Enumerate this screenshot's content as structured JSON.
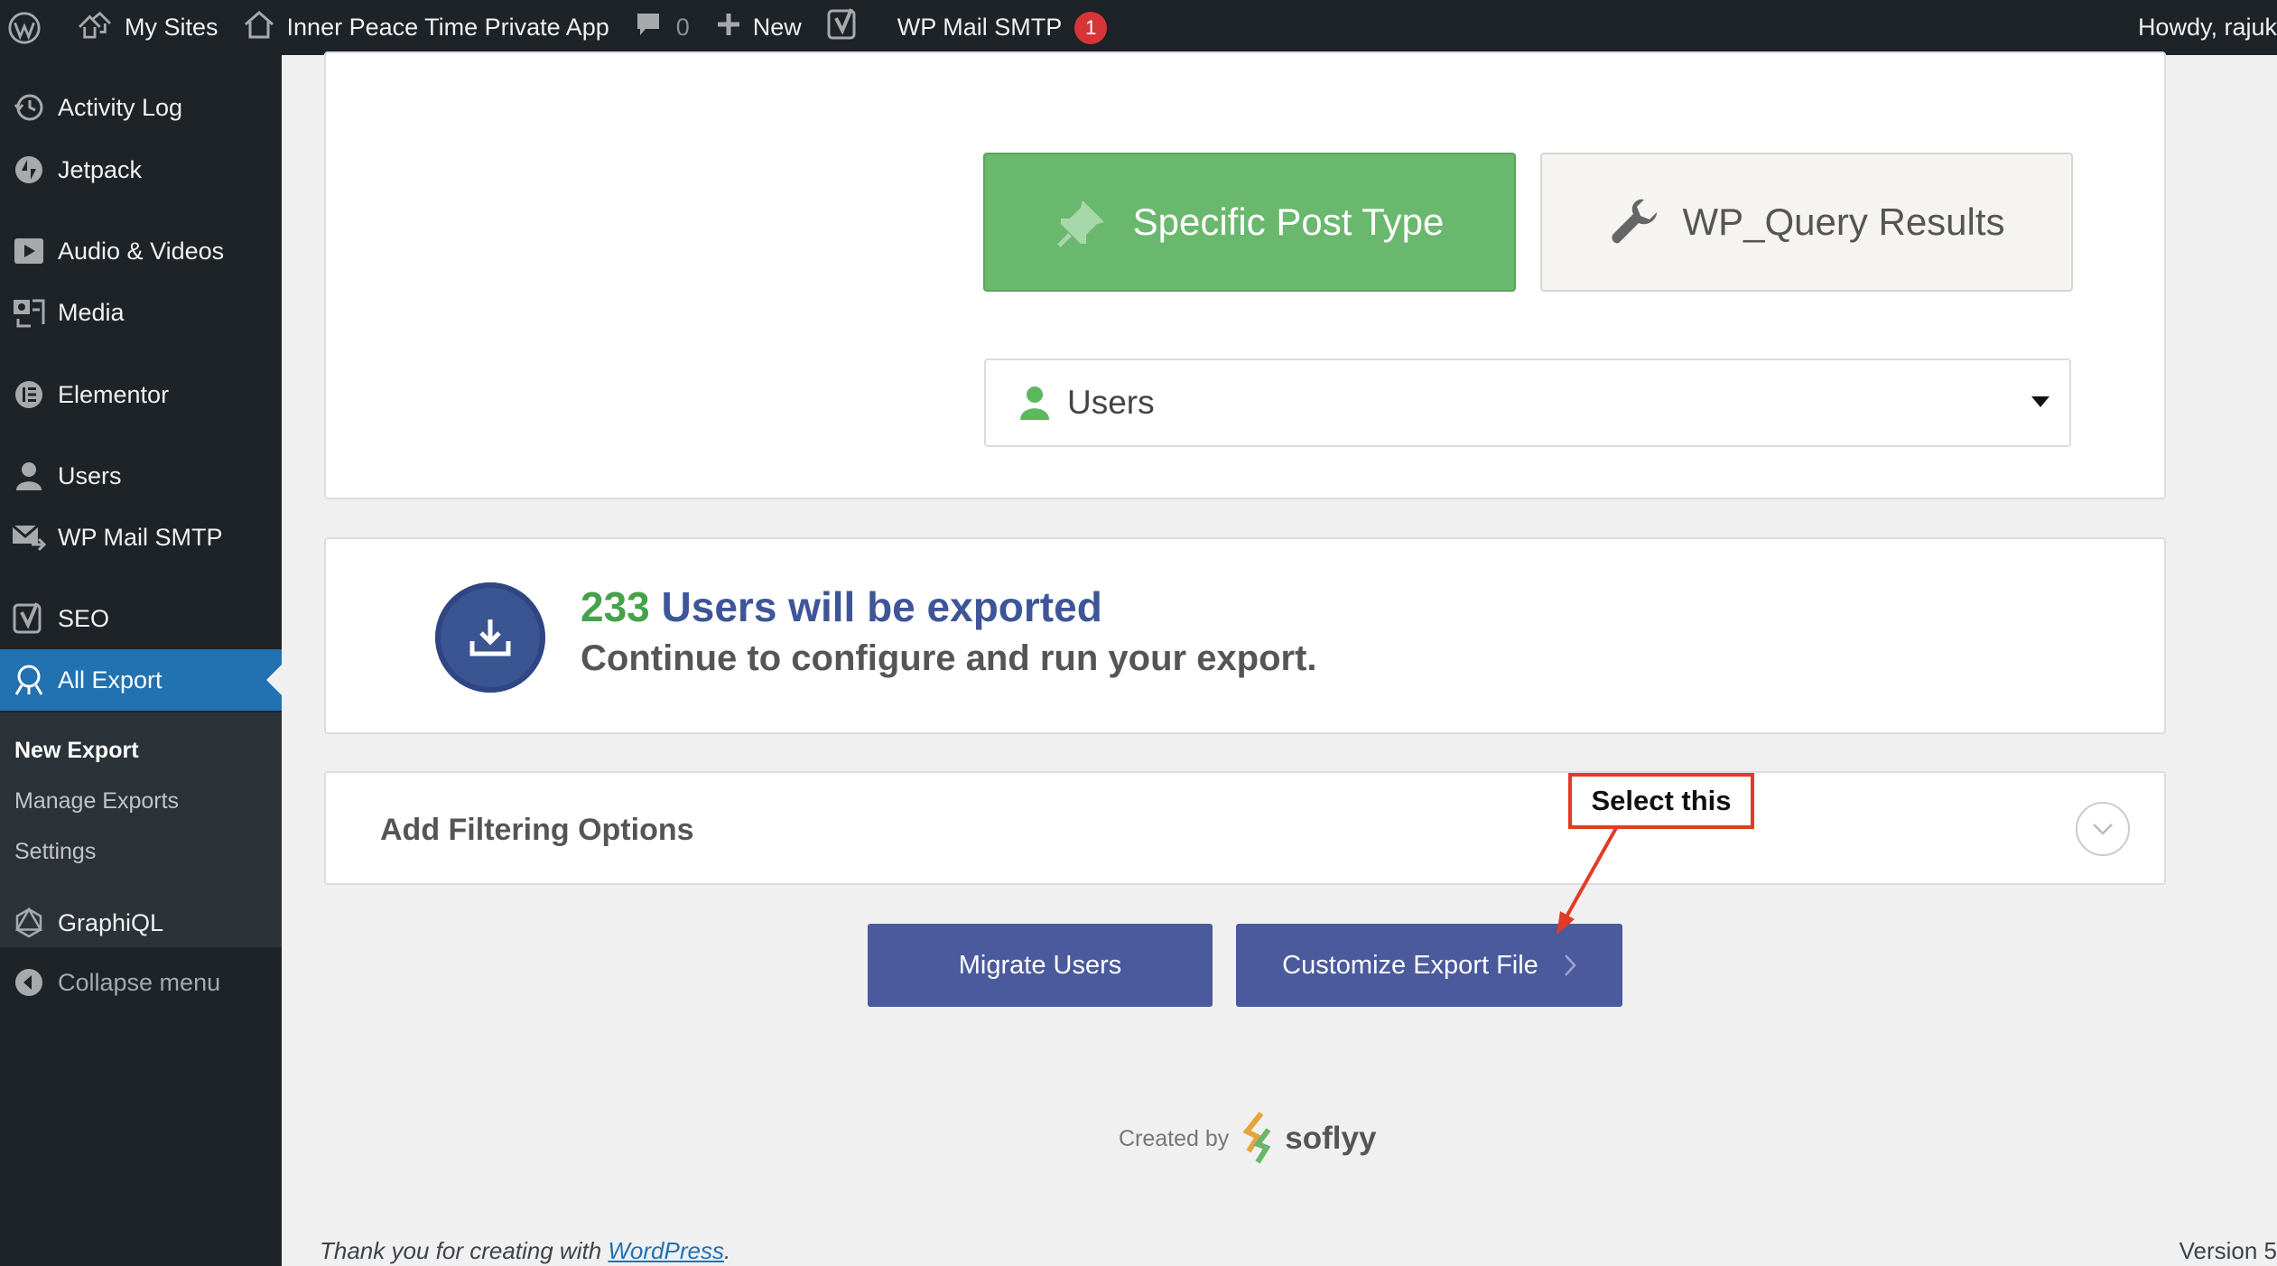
{
  "adminbar": {
    "my_sites": "My Sites",
    "site_name": "Inner Peace Time Private App",
    "comments_count": "0",
    "new_label": "New",
    "smtp_label": "WP Mail SMTP",
    "smtp_badge": "1",
    "howdy": "Howdy, rajuk"
  },
  "sidebar": {
    "items": [
      {
        "label": "Activity Log",
        "icon": "clock-icon"
      },
      {
        "label": "Jetpack",
        "icon": "jetpack-icon"
      },
      {
        "label": "Audio & Videos",
        "icon": "video-icon"
      },
      {
        "label": "Media",
        "icon": "media-icon"
      },
      {
        "label": "Elementor",
        "icon": "elementor-icon"
      },
      {
        "label": "Users",
        "icon": "user-icon"
      },
      {
        "label": "WP Mail SMTP",
        "icon": "mail-icon"
      },
      {
        "label": "SEO",
        "icon": "yoast-icon"
      },
      {
        "label": "All Export",
        "icon": "export-icon"
      },
      {
        "label": "GraphiQL",
        "icon": "graphql-icon"
      },
      {
        "label": "Collapse menu",
        "icon": "collapse-icon"
      }
    ],
    "submenu": [
      "New Export",
      "Manage Exports",
      "Settings"
    ]
  },
  "main": {
    "type_buttons": {
      "specific": "Specific Post Type",
      "wpquery": "WP_Query Results"
    },
    "select_value": "Users",
    "export_count": "233",
    "export_headline": "Users will be exported",
    "export_sub": "Continue to configure and run your export.",
    "filter_title": "Add Filtering Options",
    "callout": "Select this",
    "migrate_button": "Migrate Users",
    "customize_button": "Customize Export File",
    "created_by": "Created by",
    "brand": "soflyy"
  },
  "footer": {
    "thank_you": "Thank you for creating with ",
    "wordpress": "WordPress",
    "period": ".",
    "version": "Version 5"
  },
  "colors": {
    "admin_dark": "#1d2327",
    "wp_blue": "#2271b1",
    "green": "#6ab86d",
    "navy": "#4a5a9c",
    "callout_red": "#e03c24"
  }
}
